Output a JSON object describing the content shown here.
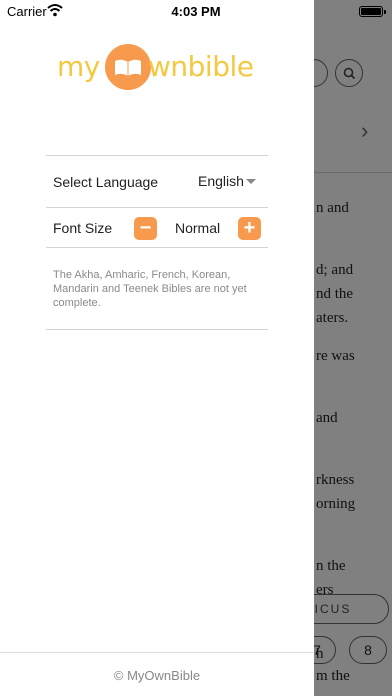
{
  "status_bar": {
    "carrier": "Carrier",
    "time": "4:03 PM"
  },
  "drawer": {
    "logo": {
      "part1": "my",
      "part2": "wnbible"
    },
    "language": {
      "label": "Select Language",
      "value": "English"
    },
    "font_size": {
      "label": "Font Size",
      "value": "Normal",
      "decrease": "−",
      "increase": "+"
    },
    "note": "The Akha, Amharic, French, Korean, Mandarin and Teenek Bibles are not yet complete.",
    "footer": "© MyOwnBible"
  },
  "reader": {
    "lines": [
      "n and",
      "d; and",
      "nd the",
      "aters.",
      "re was",
      "and",
      "rkness",
      "orning",
      "n the",
      "ers"
    ],
    "book_pill": "ITICUS",
    "chapters": [
      "7",
      "8"
    ],
    "bottom_lines": [
      "h",
      "m the"
    ]
  },
  "colors": {
    "accent": "#f79a4e",
    "logo_yellow": "#f5c842",
    "overlay_gray": "#808080"
  },
  "icons": [
    "wifi-icon",
    "battery-icon",
    "search-icon",
    "chevron-right-icon",
    "caret-down-icon",
    "minus-icon",
    "plus-icon"
  ]
}
